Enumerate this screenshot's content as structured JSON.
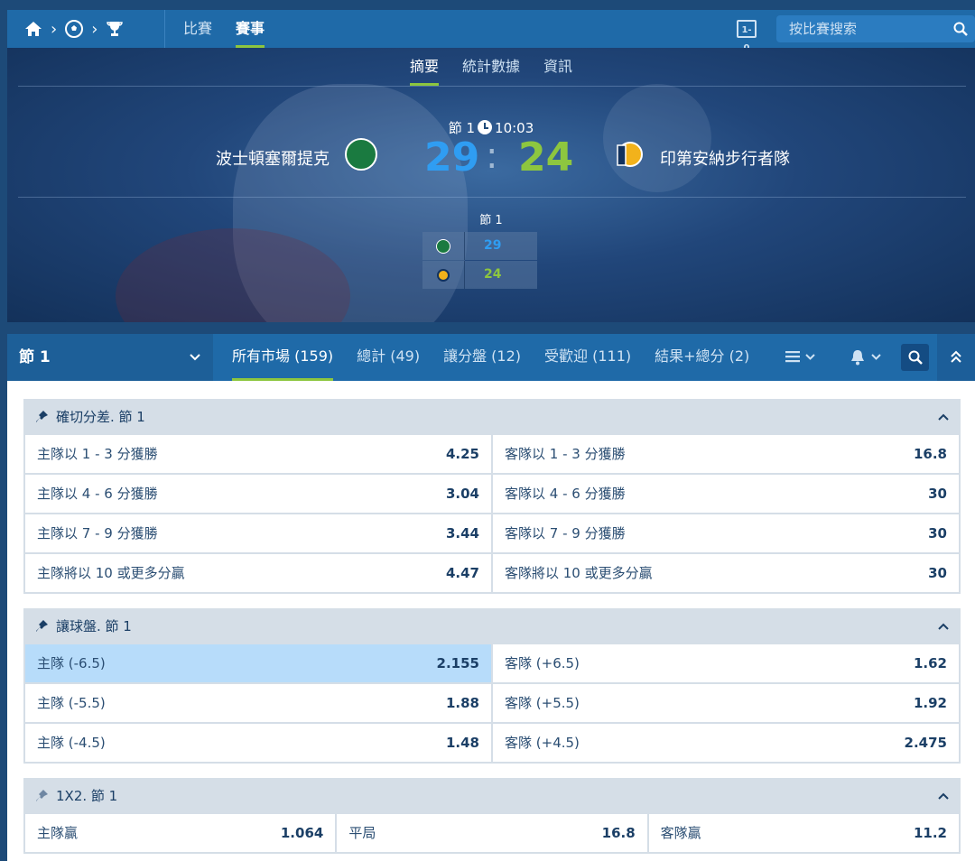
{
  "topnav": {
    "items": [
      "比賽",
      "賽事"
    ],
    "active": 1,
    "search_placeholder": "按比賽搜索"
  },
  "match": {
    "subtabs": [
      "摘要",
      "統計數據",
      "資訊"
    ],
    "period": "節 1",
    "clock": "10:03",
    "home": {
      "name": "波士頓塞爾提克",
      "score": "29"
    },
    "away": {
      "name": "印第安納步行者隊",
      "score": "24"
    },
    "quarter_label": "節 1",
    "quarter_scores": [
      "29",
      "24"
    ]
  },
  "market_bar": {
    "selector": "節 1",
    "tabs": [
      "所有市場 (159)",
      "總計 (49)",
      "讓分盤 (12)",
      "受歡迎 (111)",
      "結果+總分 (2)"
    ]
  },
  "groups": [
    {
      "title": "確切分差. 節 1",
      "rows": [
        [
          {
            "label": "主隊以 1 - 3 分獲勝",
            "odds": "4.25"
          },
          {
            "label": "客隊以 1 - 3 分獲勝",
            "odds": "16.8"
          }
        ],
        [
          {
            "label": "主隊以 4 - 6 分獲勝",
            "odds": "3.04"
          },
          {
            "label": "客隊以 4 - 6 分獲勝",
            "odds": "30"
          }
        ],
        [
          {
            "label": "主隊以 7 - 9 分獲勝",
            "odds": "3.44"
          },
          {
            "label": "客隊以 7 - 9 分獲勝",
            "odds": "30"
          }
        ],
        [
          {
            "label": "主隊將以 10 或更多分贏",
            "odds": "4.47"
          },
          {
            "label": "客隊將以 10 或更多分贏",
            "odds": "30"
          }
        ]
      ]
    },
    {
      "title": "讓球盤. 節 1",
      "rows": [
        [
          {
            "label": "主隊 (-6.5)",
            "odds": "2.155",
            "selected": true
          },
          {
            "label": "客隊 (+6.5)",
            "odds": "1.62"
          }
        ],
        [
          {
            "label": "主隊 (-5.5)",
            "odds": "1.88"
          },
          {
            "label": "客隊 (+5.5)",
            "odds": "1.92"
          }
        ],
        [
          {
            "label": "主隊 (-4.5)",
            "odds": "1.48"
          },
          {
            "label": "客隊 (+4.5)",
            "odds": "2.475"
          }
        ]
      ]
    },
    {
      "title": "1X2. 節 1",
      "rows": [
        [
          {
            "label": "主隊贏",
            "odds": "1.064"
          },
          {
            "label": "平局",
            "odds": "16.8"
          },
          {
            "label": "客隊贏",
            "odds": "11.2"
          }
        ]
      ]
    }
  ]
}
